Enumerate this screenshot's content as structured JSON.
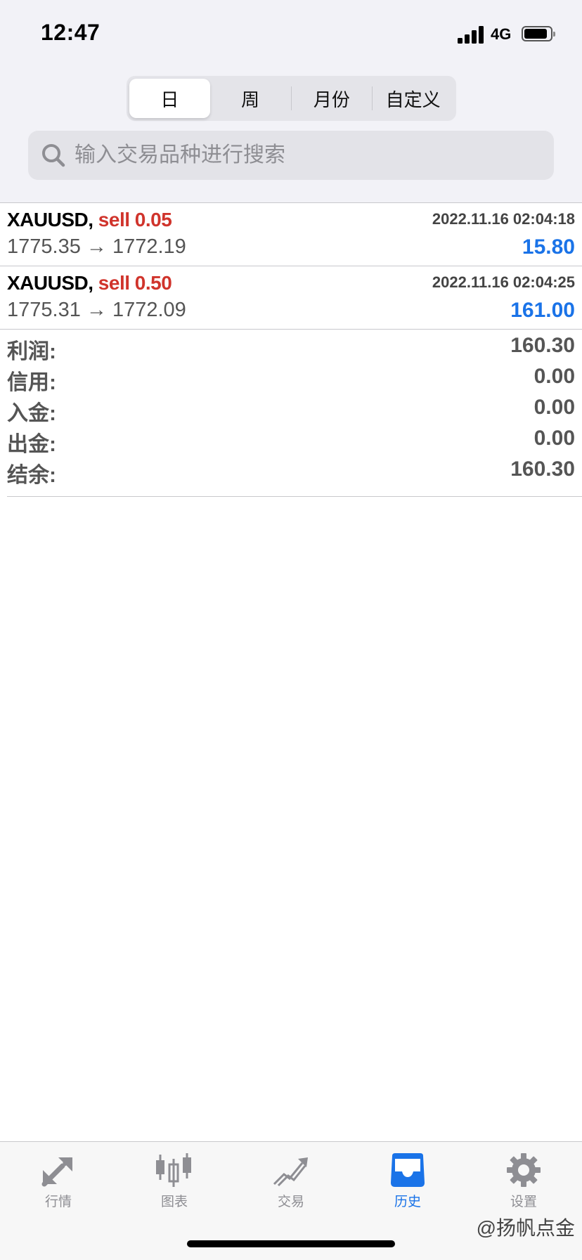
{
  "status_bar": {
    "time": "12:47",
    "network": "4G"
  },
  "segments": {
    "day": "日",
    "week": "周",
    "month": "月份",
    "custom": "自定义",
    "active": "day"
  },
  "search": {
    "placeholder": "输入交易品种进行搜索"
  },
  "trades": [
    {
      "symbol": "XAUUSD,",
      "side": "sell 0.05",
      "datetime": "2022.11.16 02:04:18",
      "prices": "1775.35 → 1772.19",
      "profit": "15.80"
    },
    {
      "symbol": "XAUUSD,",
      "side": "sell 0.50",
      "datetime": "2022.11.16 02:04:25",
      "prices": "1775.31 → 1772.09",
      "profit": "161.00"
    }
  ],
  "summary": {
    "profit_label": "利润:",
    "profit": "160.30",
    "credit_label": "信用:",
    "credit": "0.00",
    "deposit_label": "入金:",
    "deposit": "0.00",
    "withdrawal_label": "出金:",
    "withdrawal": "0.00",
    "balance_label": "结余:",
    "balance": "160.30"
  },
  "tabs": {
    "quotes": "行情",
    "charts": "图表",
    "trade": "交易",
    "history": "历史",
    "settings": "设置",
    "active": "history"
  },
  "watermark": "@扬帆点金",
  "colors": {
    "sell": "#d0342c",
    "profit": "#1a73e8",
    "active_tab": "#1a73e8",
    "inactive_tab": "#8e8e93"
  }
}
